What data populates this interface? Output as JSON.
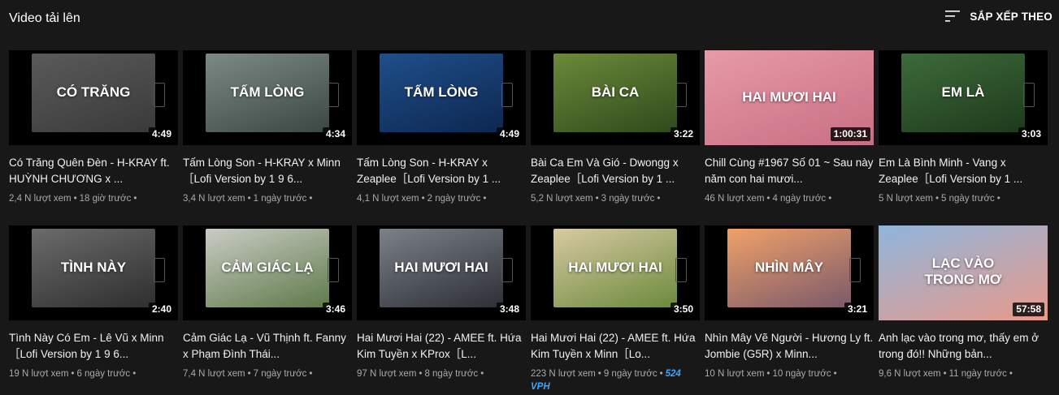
{
  "header": {
    "title": "Video tải lên",
    "sort_label": "SẮP XẾP THEO",
    "sort_icon": "sort-icon"
  },
  "videos": [
    {
      "thumb_text": "CÓ TRĂNG",
      "duration": "4:49",
      "title": "Có Trăng Quên Đèn - H-KRAY ft. HUỲNH CHƯƠNG x ...",
      "views": "2,4 N lượt xem",
      "time": "18 giờ trước",
      "colors": [
        "#5b5a5a",
        "#3a3a3a"
      ]
    },
    {
      "thumb_text": "TẤM LÒNG",
      "duration": "4:34",
      "title": "Tấm Lòng Son - H-KRAY x Minn［Lofi Version by 1 9 6...",
      "views": "3,4 N lượt xem",
      "time": "1 ngày trước",
      "colors": [
        "#7c8a86",
        "#3c4744"
      ]
    },
    {
      "thumb_text": "TẤM LÒNG",
      "duration": "4:49",
      "title": "Tấm Lòng Son - H-KRAY x Zeaplee［Lofi Version by 1 ...",
      "views": "4,1 N lượt xem",
      "time": "2 ngày trước",
      "colors": [
        "#1f4f8a",
        "#0d2750"
      ]
    },
    {
      "thumb_text": "BÀI CA",
      "duration": "3:22",
      "title": "Bài Ca Em Và Gió - Dwongg x Zeaplee［Lofi Version by 1 ...",
      "views": "5,2 N lượt xem",
      "time": "3 ngày trước",
      "colors": [
        "#6c8a3a",
        "#2f4a1c"
      ]
    },
    {
      "thumb_text": "HAI MƯƠI HAI",
      "duration": "1:00:31",
      "title": "Chill Cùng #1967 Số 01 ~ Sau này năm con hai mươi...",
      "views": "46 N lượt xem",
      "time": "4 ngày trước",
      "colors": [
        "#e79aa8",
        "#c86f83"
      ],
      "full": true
    },
    {
      "thumb_text": "EM LÀ",
      "duration": "3:03",
      "title": "Em Là Bình Minh - Vang x Zeaplee［Lofi Version by 1 ...",
      "views": "5 N lượt xem",
      "time": "5 ngày trước",
      "colors": [
        "#3d6b3a",
        "#1e3a1c"
      ]
    },
    {
      "thumb_text": "TÌNH NÀY",
      "duration": "2:40",
      "title": "Tình Này Có Em - Lê Vũ x Minn［Lofi Version by 1 9 6...",
      "views": "19 N lượt xem",
      "time": "6 ngày trước",
      "colors": [
        "#6b6b6b",
        "#2e2e2e"
      ]
    },
    {
      "thumb_text": "CẢM GIÁC LẠ",
      "duration": "3:46",
      "title": "Cảm Giác Lạ - Vũ Thịnh ft. Fanny x Phạm Đình Thái...",
      "views": "7,4 N lượt xem",
      "time": "7 ngày trước",
      "colors": [
        "#c9ccc4",
        "#5f7a4a"
      ]
    },
    {
      "thumb_text": "HAI MƯƠI HAI",
      "duration": "3:48",
      "title": "Hai Mươi Hai (22) - AMEE ft. Hứa Kim Tuyền x KProx［L...",
      "views": "97 N lượt xem",
      "time": "8 ngày trước",
      "colors": [
        "#7c8088",
        "#2c2f36"
      ]
    },
    {
      "thumb_text": "HAI MƯƠI HAI",
      "duration": "3:50",
      "title": "Hai Mươi Hai (22) - AMEE ft. Hứa Kim Tuyền x Minn［Lo...",
      "views": "223 N lượt xem",
      "time": "9 ngày trước",
      "vph": "524 VPH",
      "colors": [
        "#d8c9a2",
        "#6b8a3c"
      ]
    },
    {
      "thumb_text": "NHÌN MÂY",
      "duration": "3:21",
      "title": "Nhìn Mây Vẽ Người - Hương Ly ft. Jombie (G5R) x Minn...",
      "views": "10 N lượt xem",
      "time": "10 ngày trước",
      "colors": [
        "#f0a06a",
        "#7a5a6a"
      ]
    },
    {
      "thumb_text": "LẠC VÀO\nTRONG MƠ",
      "duration": "57:58",
      "title": "Anh lạc vào trong mơ, thấy em ở trong đó!! Những bản...",
      "views": "9,6 N lượt xem",
      "time": "11 ngày trước",
      "colors": [
        "#8fb5dc",
        "#e89a8a"
      ],
      "full": true
    }
  ]
}
